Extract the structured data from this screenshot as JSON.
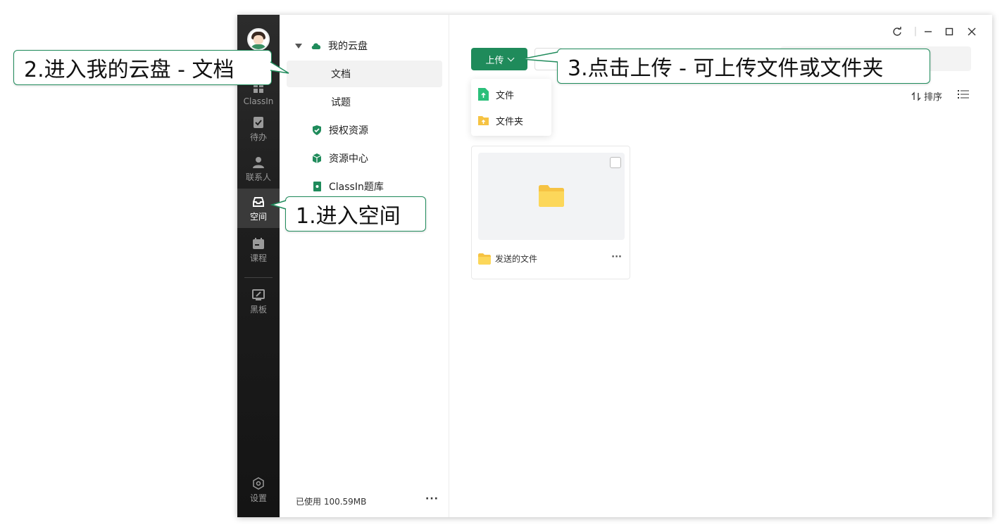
{
  "colors": {
    "accent": "#1f8b5b",
    "rail_bg": "#1e1e1e",
    "folder": "#f6c343"
  },
  "rail": {
    "brand_label": "ClassIn",
    "items": [
      {
        "label": "待办",
        "icon": "checklist-icon"
      },
      {
        "label": "联系人",
        "icon": "person-icon"
      },
      {
        "label": "空间",
        "icon": "inbox-icon",
        "active": true
      },
      {
        "label": "课程",
        "icon": "calendar-icon"
      },
      {
        "label": "黑板",
        "icon": "blackboard-icon"
      }
    ],
    "settings_label": "设置"
  },
  "nav": {
    "cloud_label": "我的云盘",
    "docs_label": "文档",
    "quiz_label": "试题",
    "authorized_label": "授权资源",
    "resource_center_label": "资源中心",
    "question_bank_label": "ClassIn题库",
    "usage": "已使用 100.59MB",
    "more": "···"
  },
  "toolbar": {
    "upload_label": "上传",
    "sort_label": "排序"
  },
  "upload_menu": {
    "file_label": "文件",
    "folder_label": "文件夹"
  },
  "files": [
    {
      "name": "发送的文件",
      "type": "folder"
    }
  ],
  "card_more": "···",
  "callouts": {
    "step1": "1.进入空间",
    "step2": "2.进入我的云盘 - 文档",
    "step3": "3.点击上传 - 可上传文件或文件夹"
  }
}
